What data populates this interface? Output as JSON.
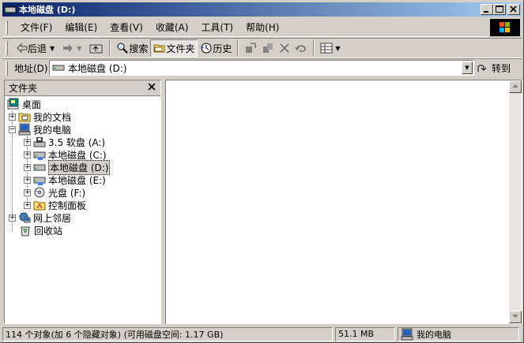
{
  "window": {
    "title": "本地磁盘 (D:)"
  },
  "menubar": {
    "items": [
      "文件(F)",
      "编辑(E)",
      "查看(V)",
      "收藏(A)",
      "工具(T)",
      "帮助(H)"
    ]
  },
  "toolbar": {
    "back_label": "后退",
    "search_label": "搜索",
    "folders_label": "文件夹",
    "history_label": "历史"
  },
  "addressbar": {
    "label": "地址(D)",
    "value": "本地磁盘 (D:)",
    "go_label": "转到"
  },
  "folders_pane": {
    "title": "文件夹",
    "tree": [
      {
        "label": "桌面",
        "icon": "desktop-icon"
      },
      {
        "label": "我的文档",
        "icon": "folder-icon"
      },
      {
        "label": "我的电脑",
        "icon": "computer-icon"
      },
      {
        "label": "3.5 软盘 (A:)",
        "icon": "floppy-icon"
      },
      {
        "label": "本地磁盘 (C:)",
        "icon": "hard-disk-icon"
      },
      {
        "label": "本地磁盘 (D:)",
        "icon": "hard-disk-icon",
        "selected": true
      },
      {
        "label": "本地磁盘 (E:)",
        "icon": "hard-disk-icon"
      },
      {
        "label": "光盘 (F:)",
        "icon": "cdrom-icon"
      },
      {
        "label": "控制面板",
        "icon": "control-panel-icon"
      },
      {
        "label": "网上邻居",
        "icon": "network-icon"
      },
      {
        "label": "回收站",
        "icon": "recycle-bin-icon"
      }
    ]
  },
  "statusbar": {
    "objects": "114 个对象(加 6 个隐藏对象) (可用磁盘空间: 1.17 GB)",
    "size": "51.1 MB",
    "location": "我的电脑"
  },
  "colors": {
    "titlebar_start": "#0a246a",
    "titlebar_end": "#a6caf0",
    "face": "#d4d0c8"
  }
}
